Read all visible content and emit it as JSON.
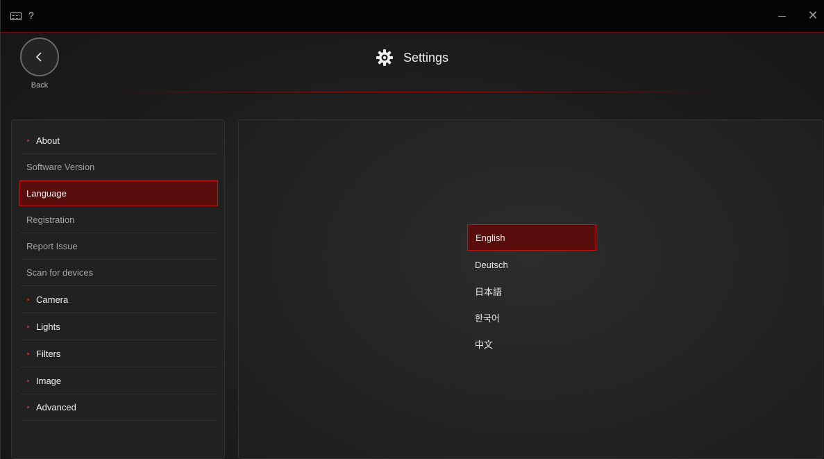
{
  "titlebar": {
    "keyboard_icon": "keyboard-icon",
    "help_label": "?",
    "close_label": "✕"
  },
  "header": {
    "back_label": "Back",
    "title": "Settings",
    "title_icon": "gear-icon"
  },
  "sidebar": {
    "items": [
      {
        "label": "About",
        "kind": "section"
      },
      {
        "label": "Software Version",
        "kind": "sub"
      },
      {
        "label": "Language",
        "kind": "sub",
        "active": true
      },
      {
        "label": "Registration",
        "kind": "sub"
      },
      {
        "label": "Report Issue",
        "kind": "sub"
      },
      {
        "label": "Scan for devices",
        "kind": "sub"
      },
      {
        "label": "Camera",
        "kind": "section"
      },
      {
        "label": "Lights",
        "kind": "section"
      },
      {
        "label": "Filters",
        "kind": "section"
      },
      {
        "label": "Image",
        "kind": "section"
      },
      {
        "label": "Advanced",
        "kind": "section"
      }
    ]
  },
  "language": {
    "options": [
      {
        "label": "English",
        "selected": true
      },
      {
        "label": "Deutsch"
      },
      {
        "label": "日本語"
      },
      {
        "label": "한국어"
      },
      {
        "label": "中文"
      }
    ]
  },
  "colors": {
    "accent": "#c41414",
    "accent_fill": "#5a0d0d",
    "background": "#1a1a1a"
  }
}
